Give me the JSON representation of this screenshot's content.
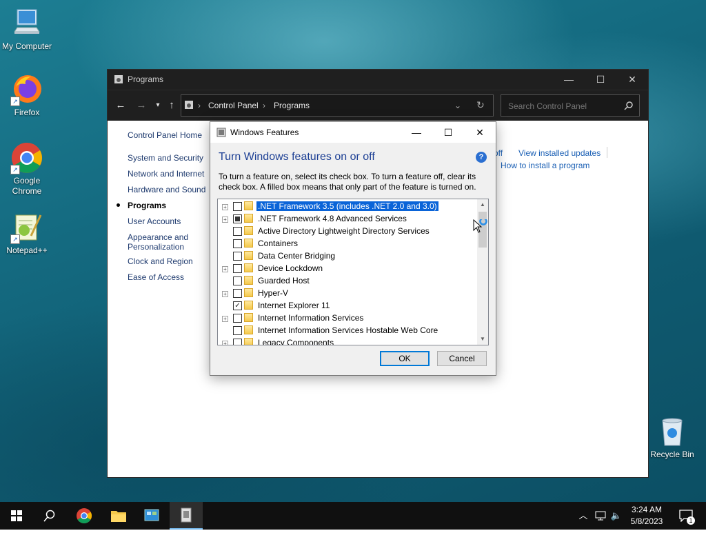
{
  "desktop": {
    "icons": [
      {
        "label": "My Computer"
      },
      {
        "label": "Firefox"
      },
      {
        "label": "Google Chrome"
      },
      {
        "label": "Notepad++"
      },
      {
        "label": "Recycle Bin"
      }
    ]
  },
  "control_panel": {
    "window_title": "Programs",
    "address": {
      "crumbs": [
        "Control Panel",
        "Programs"
      ]
    },
    "search": {
      "placeholder": "Search Control Panel"
    },
    "left_nav": [
      {
        "label": "Control Panel Home"
      },
      {
        "label": "System and Security"
      },
      {
        "label": "Network and Internet"
      },
      {
        "label": "Hardware and Sound"
      },
      {
        "label": "Programs"
      },
      {
        "label": "User Accounts"
      },
      {
        "label": "Appearance and Personalization"
      },
      {
        "label": "Clock and Region"
      },
      {
        "label": "Ease of Access"
      }
    ],
    "content_links": {
      "partial": "off",
      "view_updates": "View installed updates",
      "how_to_install": "How to install a program"
    }
  },
  "windows_features": {
    "title": "Windows Features",
    "heading": "Turn Windows features on or off",
    "help": "?",
    "description": "To turn a feature on, select its check box. To turn a feature off, clear its check box. A filled box means that only part of the feature is turned on.",
    "features": [
      {
        "label": ".NET Framework 3.5 (includes .NET 2.0 and 3.0)",
        "expandable": true,
        "state": "unchecked",
        "selected": true
      },
      {
        "label": ".NET Framework 4.8 Advanced Services",
        "expandable": true,
        "state": "partial",
        "selected": false
      },
      {
        "label": "Active Directory Lightweight Directory Services",
        "expandable": false,
        "state": "unchecked",
        "selected": false
      },
      {
        "label": "Containers",
        "expandable": false,
        "state": "unchecked",
        "selected": false
      },
      {
        "label": "Data Center Bridging",
        "expandable": false,
        "state": "unchecked",
        "selected": false
      },
      {
        "label": "Device Lockdown",
        "expandable": true,
        "state": "unchecked",
        "selected": false
      },
      {
        "label": "Guarded Host",
        "expandable": false,
        "state": "unchecked",
        "selected": false
      },
      {
        "label": "Hyper-V",
        "expandable": true,
        "state": "unchecked",
        "selected": false
      },
      {
        "label": "Internet Explorer 11",
        "expandable": false,
        "state": "checked",
        "selected": false
      },
      {
        "label": "Internet Information Services",
        "expandable": true,
        "state": "unchecked",
        "selected": false
      },
      {
        "label": "Internet Information Services Hostable Web Core",
        "expandable": false,
        "state": "unchecked",
        "selected": false
      },
      {
        "label": "Legacy Components",
        "expandable": true,
        "state": "unchecked",
        "selected": false
      }
    ],
    "buttons": {
      "ok": "OK",
      "cancel": "Cancel"
    }
  },
  "taskbar": {
    "clock": {
      "time": "3:24 AM",
      "date": "5/8/2023"
    },
    "notification_count": "1"
  },
  "colors": {
    "accent": "#0078d7",
    "selection": "#0a64d8",
    "link": "#1a5fb4",
    "heading": "#1c3f94"
  }
}
